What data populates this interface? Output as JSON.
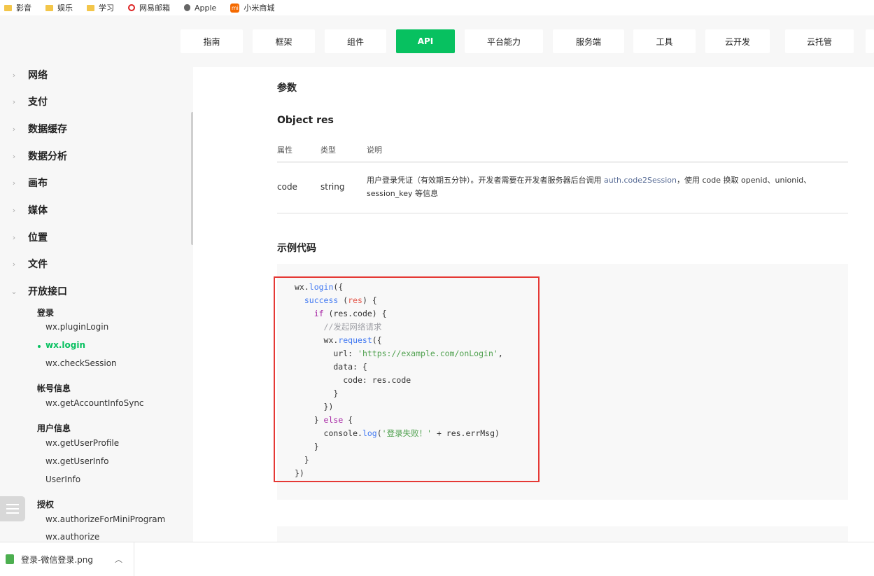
{
  "bookmarks": [
    {
      "label": "影音",
      "icon": "folder-icon"
    },
    {
      "label": "娱乐",
      "icon": "folder-icon"
    },
    {
      "label": "学习",
      "icon": "folder-icon"
    },
    {
      "label": "网易邮箱",
      "icon": "netease-icon"
    },
    {
      "label": "Apple",
      "icon": "apple-icon"
    },
    {
      "label": "小米商城",
      "icon": "mi-icon"
    }
  ],
  "nav": {
    "tabs": [
      "指南",
      "框架",
      "组件",
      "API",
      "平台能力",
      "服务端",
      "工具",
      "云开发",
      "云托管"
    ],
    "active": "API"
  },
  "sidebar": {
    "categories": [
      "网络",
      "支付",
      "数据缓存",
      "数据分析",
      "画布",
      "媒体",
      "位置",
      "文件",
      "开放接口"
    ],
    "groups": [
      {
        "heading": "登录",
        "items": [
          "wx.pluginLogin",
          "wx.login",
          "wx.checkSession"
        ]
      },
      {
        "heading": "帐号信息",
        "items": [
          "wx.getAccountInfoSync"
        ]
      },
      {
        "heading": "用户信息",
        "items": [
          "wx.getUserProfile",
          "wx.getUserInfo",
          "UserInfo"
        ]
      },
      {
        "heading": "授权",
        "items": [
          "wx.authorizeForMiniProgram",
          "wx.authorize"
        ]
      }
    ],
    "active_item": "wx.login"
  },
  "main": {
    "params_heading": "参数",
    "object_heading": "Object res",
    "table": {
      "headers": [
        "属性",
        "类型",
        "说明"
      ],
      "row": {
        "name": "code",
        "type": "string",
        "desc_before": "用户登录凭证（有效期五分钟）。开发者需要在开发者服务器后台调用 ",
        "desc_link": "auth.code2Session",
        "desc_after": "，使用 code 换取 openid、unionid、session_key 等信息"
      }
    },
    "example_heading": "示例代码"
  },
  "download": {
    "filename": "登录-微信登录.png"
  }
}
